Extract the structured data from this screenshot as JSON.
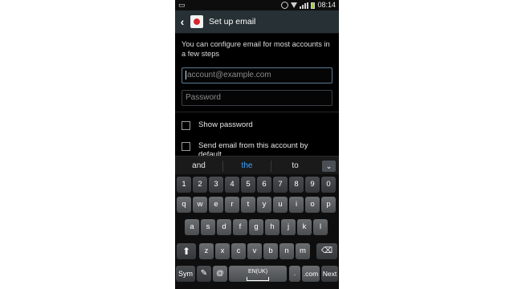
{
  "status_bar": {
    "time": "08:14"
  },
  "action_bar": {
    "title": "Set up email",
    "back_icon": "chevron-left-icon",
    "app_icon": "email-app-icon"
  },
  "content": {
    "intro_text": "You can configure email for most accounts in a few steps",
    "email_field": {
      "placeholder": "account@example.com",
      "value": ""
    },
    "password_field": {
      "placeholder": "Password",
      "value": ""
    },
    "show_password_label": "Show password",
    "send_email_label": "Send email from this account by default"
  },
  "suggestions": {
    "left": "and",
    "middle": "the",
    "right": "to",
    "collapse_icon": "chevron-down-icon"
  },
  "keyboard": {
    "row1": [
      "1",
      "2",
      "3",
      "4",
      "5",
      "6",
      "7",
      "8",
      "9",
      "0"
    ],
    "row2": [
      "q",
      "w",
      "e",
      "r",
      "t",
      "y",
      "u",
      "i",
      "o",
      "p"
    ],
    "row3": [
      "a",
      "s",
      "d",
      "f",
      "g",
      "h",
      "j",
      "k",
      "l"
    ],
    "row4": [
      "z",
      "x",
      "c",
      "v",
      "b",
      "n",
      "m"
    ],
    "sym": "Sym",
    "at": "@",
    "space_label": "EN(UK)",
    "dot": ".",
    "dotcom": ".com",
    "next": "Next",
    "shift_icon": "shift-arrow-icon",
    "backspace_icon": "backspace-icon",
    "settings_icon": "handwriting-settings-icon"
  }
}
